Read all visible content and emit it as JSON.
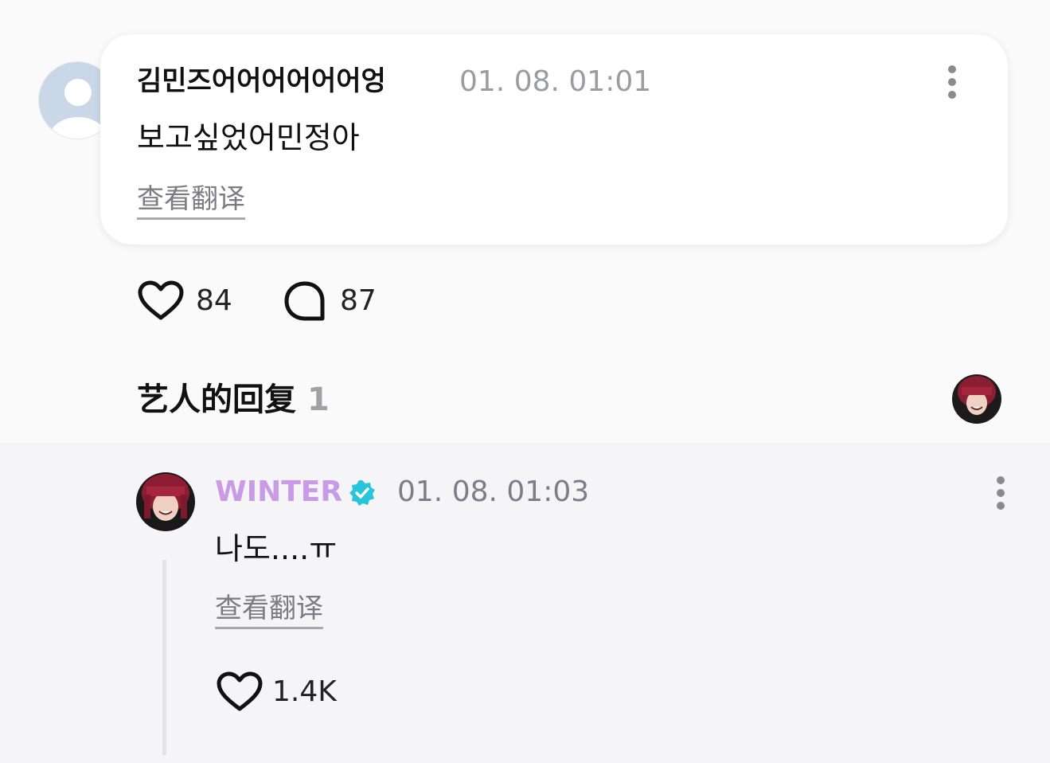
{
  "comment": {
    "author": "김민즈어어어어어어엉",
    "timestamp": "01. 08. 01:01",
    "text": "보고싶었어민정아",
    "translate_label": "查看翻译",
    "likes": "84",
    "replies": "87"
  },
  "artist_section": {
    "title": "艺人的回复",
    "count": "1"
  },
  "reply": {
    "author": "WINTER",
    "timestamp": "01. 08. 01:03",
    "text": "나도....ㅠ",
    "translate_label": "查看翻译",
    "likes": "1.4K"
  },
  "colors": {
    "artist_name": "#c99be6",
    "verified_badge": "#28c4d9",
    "muted": "#9b9ba3"
  },
  "icons": [
    "user-placeholder-icon",
    "more-vertical-icon",
    "heart-icon",
    "comment-bubble-icon",
    "verified-badge-icon"
  ]
}
